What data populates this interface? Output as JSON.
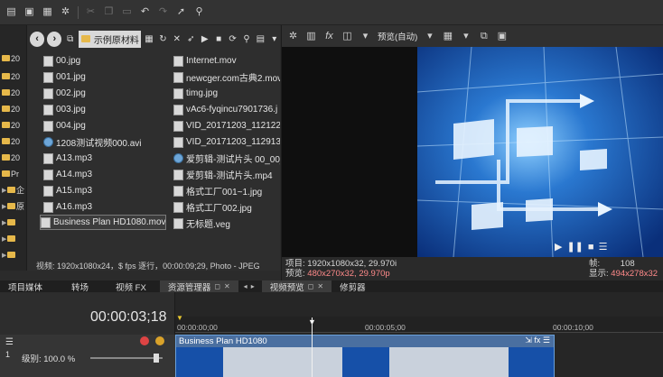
{
  "toolbar": {
    "icons": [
      "folder-open-icon",
      "save-icon",
      "save-as-icon",
      "settings-icon",
      "cut-icon",
      "copy-icon",
      "paste-icon",
      "undo-icon",
      "redo-icon",
      "pointer-icon",
      "snap-icon"
    ]
  },
  "tree": {
    "rows": [
      "20",
      "20",
      "20",
      "20",
      "20",
      "20",
      "20",
      "Pr",
      "企",
      "原"
    ]
  },
  "explorer": {
    "path_label": "示例原材料",
    "status": "视频: 1920x1080x24，$ fps 逐行，00:00:09;29, Photo - JPEG",
    "files_col1": [
      {
        "name": "00.jpg",
        "type": "image"
      },
      {
        "name": "001.jpg",
        "type": "image"
      },
      {
        "name": "002.jpg",
        "type": "image"
      },
      {
        "name": "003.jpg",
        "type": "image"
      },
      {
        "name": "004.jpg",
        "type": "image"
      },
      {
        "name": "1208测试视频000.avi",
        "type": "media"
      },
      {
        "name": "A13.mp3",
        "type": "audio"
      },
      {
        "name": "A14.mp3",
        "type": "audio"
      },
      {
        "name": "A15.mp3",
        "type": "audio"
      },
      {
        "name": "A16.mp3",
        "type": "audio"
      },
      {
        "name": "Business Plan HD1080.mov",
        "type": "video",
        "selected": true
      }
    ],
    "files_col2": [
      {
        "name": "Internet.mov",
        "type": "video"
      },
      {
        "name": "newcger.com古典2.mov",
        "type": "video"
      },
      {
        "name": "timg.jpg",
        "type": "image"
      },
      {
        "name": "vAc6-fyqincu7901736.j",
        "type": "image"
      },
      {
        "name": "VID_20171203_112122.",
        "type": "video"
      },
      {
        "name": "VID_20171203_112913.",
        "type": "video"
      },
      {
        "name": "爱剪辑-测试片头 00_00_",
        "type": "media"
      },
      {
        "name": "爱剪辑-测试片头.mp4",
        "type": "video"
      },
      {
        "name": "格式工厂001~1.jpg",
        "type": "image"
      },
      {
        "name": "格式工厂002.jpg",
        "type": "image"
      },
      {
        "name": "无标题.veg",
        "type": "project"
      }
    ]
  },
  "preview": {
    "quality_label": "预览(自动)",
    "project_label": "项目:",
    "project_value": "1920x1080x32, 29.970i",
    "preview_label": "预览:",
    "preview_value": "480x270x32, 29.970p",
    "frame_label": "帧:",
    "frame_value": "108",
    "display_label": "显示:",
    "display_value": "494x278x32"
  },
  "tabs": {
    "media": "项目媒体",
    "transitions": "转场",
    "video_fx": "视频 FX",
    "explorer": "资源管理器",
    "video_preview": "视频预览",
    "trimmer": "修剪器"
  },
  "timeline": {
    "timecode": "00:00:03;18",
    "level_label": "级别: 100.0 %",
    "ruler": [
      "00:00:00;00",
      "00:00:05;00",
      "00:00:10;00"
    ],
    "clip_title": "Business Plan HD1080"
  },
  "colors": {
    "accent": "#6aa0d8",
    "folder": "#e6b84a",
    "video_bg": "#0f3b8a"
  }
}
